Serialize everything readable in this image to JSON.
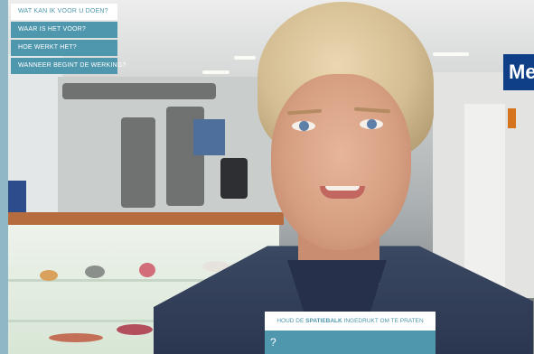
{
  "menu": {
    "header": "WAT KAN IK VOOR U DOEN?",
    "items": [
      {
        "label": "WAAR IS HET VOOR?"
      },
      {
        "label": "HOE WERKT HET?"
      },
      {
        "label": "WANNEER BEGINT DE WERKING?"
      }
    ]
  },
  "background": {
    "sign_text": "Me"
  },
  "hint": {
    "prefix": "HOUD DE",
    "key": "SPATIEBALK",
    "suffix": "INGEDRUKT OM TE PRATEN",
    "transcript": "?"
  },
  "colors": {
    "accent": "#4f97ad",
    "panel": "#ffffff",
    "frame": "#8fb8c4"
  }
}
